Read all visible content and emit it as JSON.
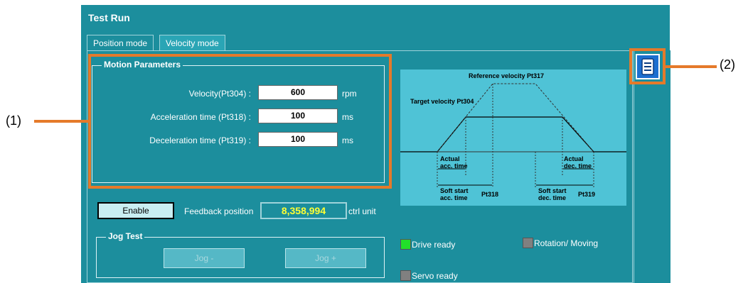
{
  "window": {
    "title": "Test Run"
  },
  "tabs": [
    {
      "label": "Position mode",
      "active": false
    },
    {
      "label": "Velocity mode",
      "active": true
    }
  ],
  "motion": {
    "legend": "Motion Parameters",
    "velocity": {
      "label": "Velocity(Pt304) :",
      "value": "600",
      "unit": "rpm"
    },
    "accel": {
      "label": "Acceleration time (Pt318) :",
      "value": "100",
      "unit": "ms"
    },
    "decel": {
      "label": "Deceleration time (Pt319) :",
      "value": "100",
      "unit": "ms"
    }
  },
  "diagram": {
    "ref_velocity": "Reference velocity Pt317",
    "target_velocity": "Target velocity Pt304",
    "actual_acc_1": "Actual",
    "actual_acc_2": "acc. time",
    "actual_dec_1": "Actual",
    "actual_dec_2": "dec. time",
    "soft_acc_1": "Soft start",
    "soft_acc_2": "acc. time",
    "soft_acc_pt": "Pt318",
    "soft_dec_1": "Soft start",
    "soft_dec_2": "dec. time",
    "soft_dec_pt": "Pt319"
  },
  "enable_button": "Enable",
  "feedback": {
    "label": "Feedback position",
    "value": "8,358,994",
    "unit": "ctrl unit"
  },
  "jog": {
    "legend": "Jog Test",
    "minus": "Jog -",
    "plus": "Jog +"
  },
  "status": [
    {
      "label": "Drive ready",
      "color": "#22e02a"
    },
    {
      "label": "Rotation/ Moving",
      "color": "#808080"
    },
    {
      "label": "Servo ready",
      "color": "#808080"
    }
  ],
  "callouts": {
    "one": "(1)",
    "two": "(2)"
  },
  "icons": {
    "report": "list-document-icon"
  },
  "colors": {
    "panel": "#1c8e9d",
    "diagram": "#4fc3d6",
    "highlight": "#e57a2a",
    "feedback_text": "#ffff33"
  }
}
